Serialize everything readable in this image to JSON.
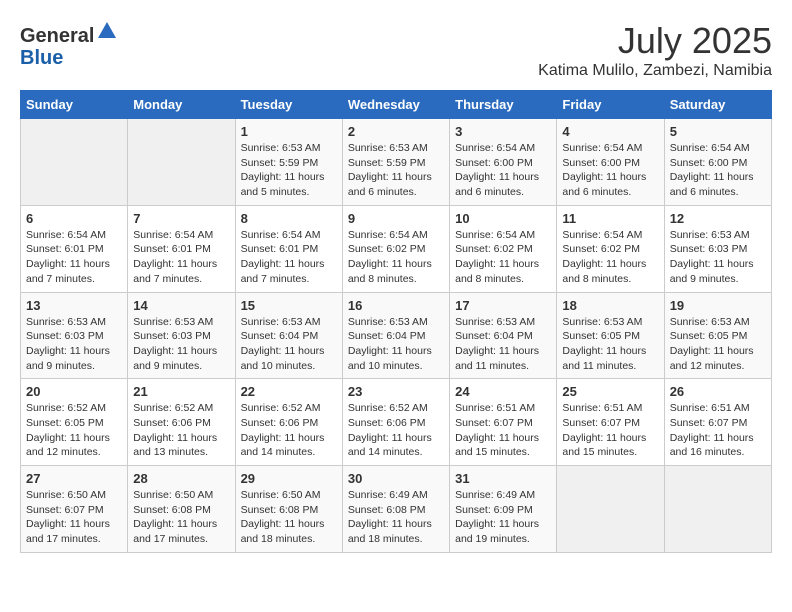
{
  "header": {
    "logo_general": "General",
    "logo_blue": "Blue",
    "month_title": "July 2025",
    "location": "Katima Mulilo, Zambezi, Namibia"
  },
  "days_of_week": [
    "Sunday",
    "Monday",
    "Tuesday",
    "Wednesday",
    "Thursday",
    "Friday",
    "Saturday"
  ],
  "weeks": [
    [
      {
        "day": "",
        "info": ""
      },
      {
        "day": "",
        "info": ""
      },
      {
        "day": "1",
        "info": "Sunrise: 6:53 AM\nSunset: 5:59 PM\nDaylight: 11 hours and 5 minutes."
      },
      {
        "day": "2",
        "info": "Sunrise: 6:53 AM\nSunset: 5:59 PM\nDaylight: 11 hours and 6 minutes."
      },
      {
        "day": "3",
        "info": "Sunrise: 6:54 AM\nSunset: 6:00 PM\nDaylight: 11 hours and 6 minutes."
      },
      {
        "day": "4",
        "info": "Sunrise: 6:54 AM\nSunset: 6:00 PM\nDaylight: 11 hours and 6 minutes."
      },
      {
        "day": "5",
        "info": "Sunrise: 6:54 AM\nSunset: 6:00 PM\nDaylight: 11 hours and 6 minutes."
      }
    ],
    [
      {
        "day": "6",
        "info": "Sunrise: 6:54 AM\nSunset: 6:01 PM\nDaylight: 11 hours and 7 minutes."
      },
      {
        "day": "7",
        "info": "Sunrise: 6:54 AM\nSunset: 6:01 PM\nDaylight: 11 hours and 7 minutes."
      },
      {
        "day": "8",
        "info": "Sunrise: 6:54 AM\nSunset: 6:01 PM\nDaylight: 11 hours and 7 minutes."
      },
      {
        "day": "9",
        "info": "Sunrise: 6:54 AM\nSunset: 6:02 PM\nDaylight: 11 hours and 8 minutes."
      },
      {
        "day": "10",
        "info": "Sunrise: 6:54 AM\nSunset: 6:02 PM\nDaylight: 11 hours and 8 minutes."
      },
      {
        "day": "11",
        "info": "Sunrise: 6:54 AM\nSunset: 6:02 PM\nDaylight: 11 hours and 8 minutes."
      },
      {
        "day": "12",
        "info": "Sunrise: 6:53 AM\nSunset: 6:03 PM\nDaylight: 11 hours and 9 minutes."
      }
    ],
    [
      {
        "day": "13",
        "info": "Sunrise: 6:53 AM\nSunset: 6:03 PM\nDaylight: 11 hours and 9 minutes."
      },
      {
        "day": "14",
        "info": "Sunrise: 6:53 AM\nSunset: 6:03 PM\nDaylight: 11 hours and 9 minutes."
      },
      {
        "day": "15",
        "info": "Sunrise: 6:53 AM\nSunset: 6:04 PM\nDaylight: 11 hours and 10 minutes."
      },
      {
        "day": "16",
        "info": "Sunrise: 6:53 AM\nSunset: 6:04 PM\nDaylight: 11 hours and 10 minutes."
      },
      {
        "day": "17",
        "info": "Sunrise: 6:53 AM\nSunset: 6:04 PM\nDaylight: 11 hours and 11 minutes."
      },
      {
        "day": "18",
        "info": "Sunrise: 6:53 AM\nSunset: 6:05 PM\nDaylight: 11 hours and 11 minutes."
      },
      {
        "day": "19",
        "info": "Sunrise: 6:53 AM\nSunset: 6:05 PM\nDaylight: 11 hours and 12 minutes."
      }
    ],
    [
      {
        "day": "20",
        "info": "Sunrise: 6:52 AM\nSunset: 6:05 PM\nDaylight: 11 hours and 12 minutes."
      },
      {
        "day": "21",
        "info": "Sunrise: 6:52 AM\nSunset: 6:06 PM\nDaylight: 11 hours and 13 minutes."
      },
      {
        "day": "22",
        "info": "Sunrise: 6:52 AM\nSunset: 6:06 PM\nDaylight: 11 hours and 14 minutes."
      },
      {
        "day": "23",
        "info": "Sunrise: 6:52 AM\nSunset: 6:06 PM\nDaylight: 11 hours and 14 minutes."
      },
      {
        "day": "24",
        "info": "Sunrise: 6:51 AM\nSunset: 6:07 PM\nDaylight: 11 hours and 15 minutes."
      },
      {
        "day": "25",
        "info": "Sunrise: 6:51 AM\nSunset: 6:07 PM\nDaylight: 11 hours and 15 minutes."
      },
      {
        "day": "26",
        "info": "Sunrise: 6:51 AM\nSunset: 6:07 PM\nDaylight: 11 hours and 16 minutes."
      }
    ],
    [
      {
        "day": "27",
        "info": "Sunrise: 6:50 AM\nSunset: 6:07 PM\nDaylight: 11 hours and 17 minutes."
      },
      {
        "day": "28",
        "info": "Sunrise: 6:50 AM\nSunset: 6:08 PM\nDaylight: 11 hours and 17 minutes."
      },
      {
        "day": "29",
        "info": "Sunrise: 6:50 AM\nSunset: 6:08 PM\nDaylight: 11 hours and 18 minutes."
      },
      {
        "day": "30",
        "info": "Sunrise: 6:49 AM\nSunset: 6:08 PM\nDaylight: 11 hours and 18 minutes."
      },
      {
        "day": "31",
        "info": "Sunrise: 6:49 AM\nSunset: 6:09 PM\nDaylight: 11 hours and 19 minutes."
      },
      {
        "day": "",
        "info": ""
      },
      {
        "day": "",
        "info": ""
      }
    ]
  ]
}
